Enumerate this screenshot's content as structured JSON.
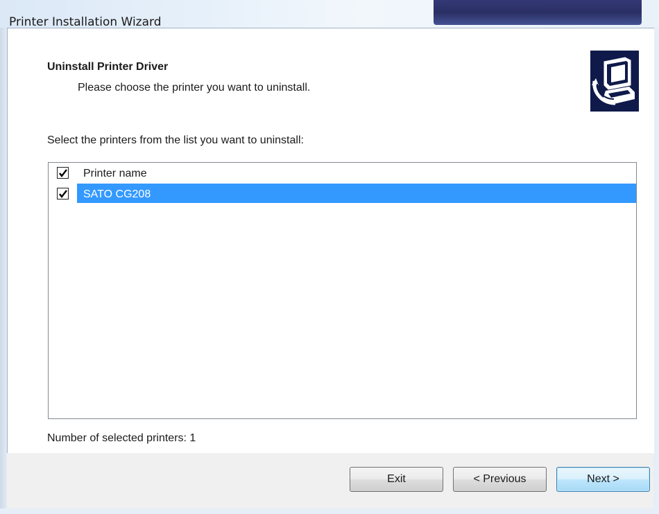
{
  "window": {
    "title": "Printer Installation Wizard"
  },
  "header": {
    "title": "Uninstall Printer Driver",
    "subtitle": "Please choose the printer you want to uninstall.",
    "icon": "printer-uninstall-icon"
  },
  "instruction": "Select the printers from the list you want to uninstall:",
  "printer_list": {
    "header": {
      "label": "Printer name",
      "checked": true
    },
    "items": [
      {
        "label": "SATO CG208",
        "checked": true,
        "selected": true
      }
    ]
  },
  "status": {
    "selected_count": "Number of selected printers: 1"
  },
  "buttons": {
    "exit": "Exit",
    "previous": "< Previous",
    "next": "Next >"
  },
  "colors": {
    "selection": "#3399ff",
    "icon_background": "#0f1a4a"
  }
}
